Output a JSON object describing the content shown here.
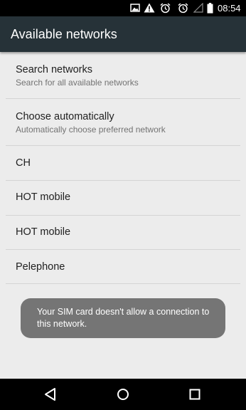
{
  "status_bar": {
    "time": "08:54",
    "icons": [
      "image-icon",
      "warning-icon",
      "alarm-icon",
      "alarm-icon",
      "signal-icon",
      "battery-icon"
    ]
  },
  "app_bar": {
    "title": "Available networks"
  },
  "list": {
    "search": {
      "title": "Search networks",
      "subtitle": "Search for all available networks"
    },
    "auto": {
      "title": "Choose automatically",
      "subtitle": "Automatically choose preferred network"
    },
    "networks": [
      {
        "name": "CH"
      },
      {
        "name": "HOT mobile"
      },
      {
        "name": "HOT mobile"
      },
      {
        "name": "Pelephone"
      }
    ]
  },
  "toast": {
    "message": "Your SIM card doesn't allow a connection to this network."
  },
  "nav": {
    "icons": [
      "back-icon",
      "home-icon",
      "recents-icon"
    ]
  },
  "colors": {
    "app_bar": "#263238",
    "background": "#ececec",
    "toast": "#757575",
    "divider": "#d4d4d4"
  }
}
